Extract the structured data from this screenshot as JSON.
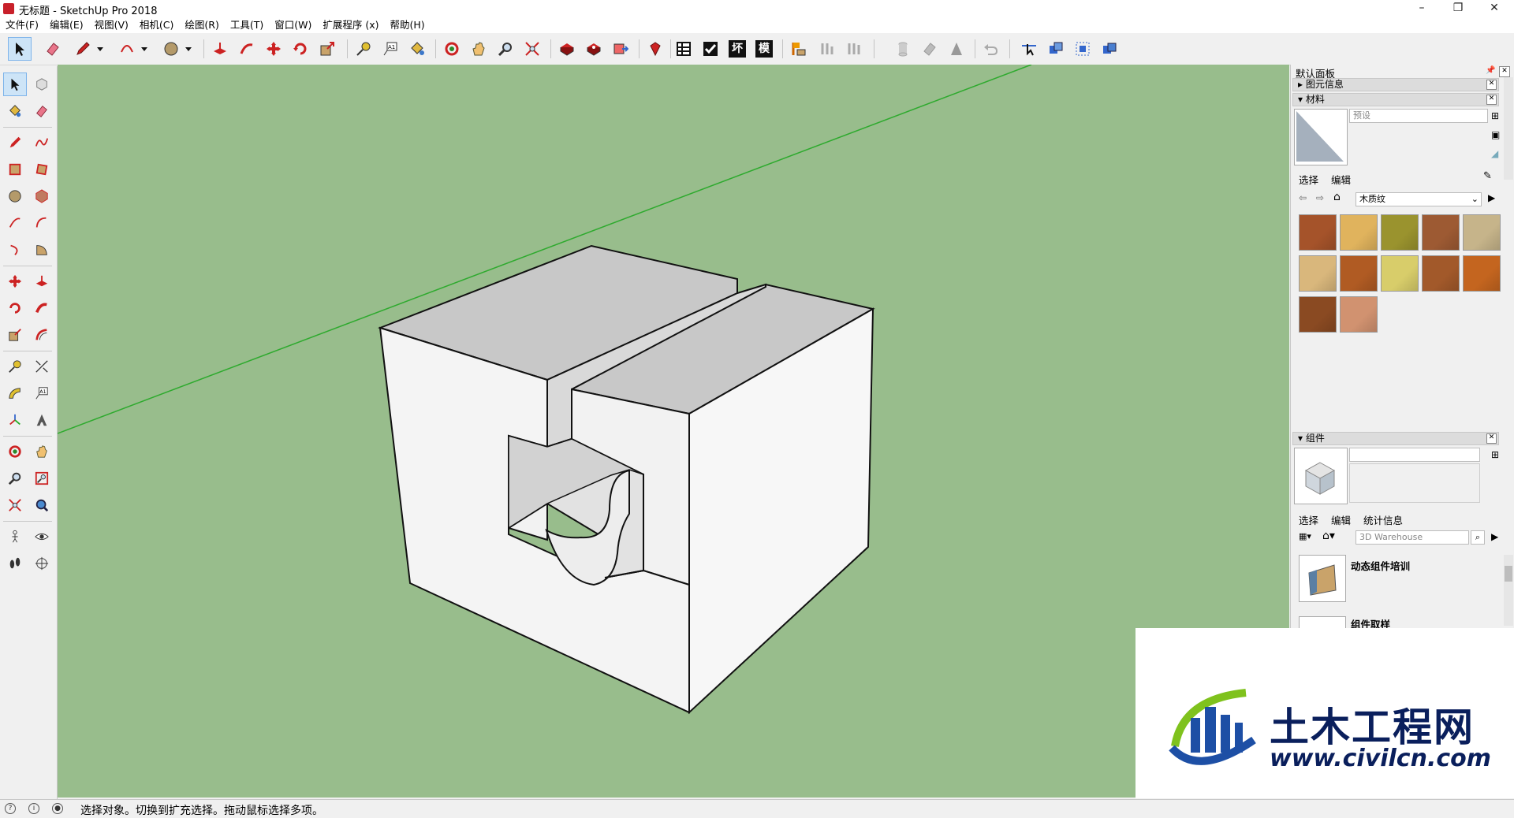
{
  "window": {
    "title": "无标题 - SketchUp Pro 2018",
    "minimize": "–",
    "restore": "❐",
    "close": "✕"
  },
  "menu": [
    "文件(F)",
    "编辑(E)",
    "视图(V)",
    "相机(C)",
    "绘图(R)",
    "工具(T)",
    "窗口(W)",
    "扩展程序 (x)",
    "帮助(H)"
  ],
  "toolbar": {
    "text_icons": [
      "坏",
      "模"
    ]
  },
  "panel": {
    "title": "默认面板",
    "entity_info": "图元信息",
    "materials": {
      "header": "材料",
      "name_placeholder": "预设",
      "tabs": [
        "选择",
        "编辑"
      ],
      "library": "木质纹",
      "swatches": [
        "#a5532a",
        "#e0b35d",
        "#9a932e",
        "#9d5a33",
        "#c6b48a",
        "#d9b77c",
        "#b05b23",
        "#d8cd6a",
        "#a2592a",
        "#c4651f",
        "#8a4a22",
        "#d19270"
      ]
    },
    "components": {
      "header": "组件",
      "tabs": [
        "选择",
        "编辑",
        "统计信息"
      ],
      "search_placeholder": "3D Warehouse",
      "items": [
        "动态组件培训",
        "组件取样"
      ]
    }
  },
  "status": {
    "message": "选择对象。切换到扩充选择。拖动鼠标选择多项。"
  },
  "watermark": {
    "cn": "土木工程网",
    "url": "www.civilcn.com"
  },
  "colors": {
    "viewport_bg": "#98bd8c",
    "axis_green": "#2eaa2e"
  }
}
